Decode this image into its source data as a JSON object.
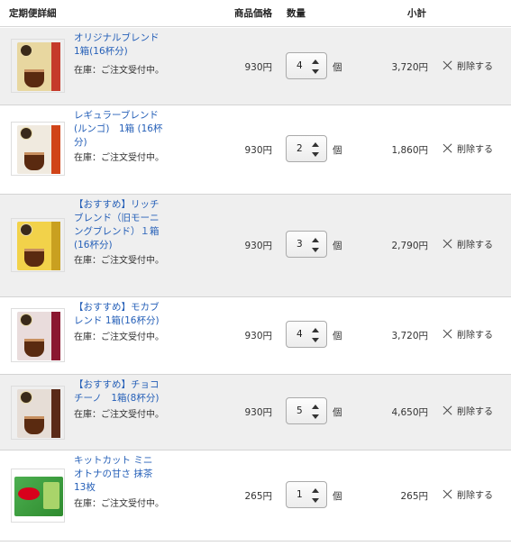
{
  "header": {
    "detail": "定期便詳細",
    "price": "商品価格",
    "quantity": "数量",
    "subtotal": "小計"
  },
  "accent_link_color": "#2660b8",
  "items": [
    {
      "name": "オリジナルブレンド 1箱(16杯分)",
      "stock": "在庫：ご注文受付中。",
      "price": "930円",
      "quantity": "4",
      "unit": "個",
      "subtotal": "3,720円",
      "delete": "削除する",
      "image_icon": "coffee-capsule-box-icon",
      "box_color": "#e8d7a0",
      "band_color": "#c53a2a"
    },
    {
      "name": "レギュラーブレンド (ルンゴ)　1箱 (16杯分)",
      "stock": "在庫：ご注文受付中。",
      "price": "930円",
      "quantity": "2",
      "unit": "個",
      "subtotal": "1,860円",
      "delete": "削除する",
      "image_icon": "coffee-capsule-box-icon",
      "box_color": "#f0eadf",
      "band_color": "#d04418"
    },
    {
      "name": "【おすすめ】リッチブレンド（旧モーニングブレンド）１箱(16杯分)",
      "stock": "在庫：ご注文受付中。",
      "price": "930円",
      "quantity": "3",
      "unit": "個",
      "subtotal": "2,790円",
      "delete": "削除する",
      "image_icon": "coffee-capsule-box-icon",
      "box_color": "#f2d24a",
      "band_color": "#c9a020"
    },
    {
      "name": "【おすすめ】モカブレンド 1箱(16杯分)",
      "stock": "在庫：ご注文受付中。",
      "price": "930円",
      "quantity": "4",
      "unit": "個",
      "subtotal": "3,720円",
      "delete": "削除する",
      "image_icon": "coffee-capsule-box-icon",
      "box_color": "#e9dcdc",
      "band_color": "#8a1730"
    },
    {
      "name": "【おすすめ】チョコチーノ　1箱(8杯分)",
      "stock": "在庫：ご注文受付中。",
      "price": "930円",
      "quantity": "5",
      "unit": "個",
      "subtotal": "4,650円",
      "delete": "削除する",
      "image_icon": "coffee-capsule-box-icon",
      "box_color": "#e6ddd6",
      "band_color": "#5a2a18"
    },
    {
      "name": "キットカット ミニ オトナの甘さ 抹茶 13枚",
      "stock": "在庫：ご注文受付中。",
      "price": "265円",
      "quantity": "1",
      "unit": "個",
      "subtotal": "265円",
      "delete": "削除する",
      "image_icon": "kitkat-matcha-pack-icon",
      "box_color": "#3f9e3f",
      "band_color": "#d8001c"
    }
  ]
}
